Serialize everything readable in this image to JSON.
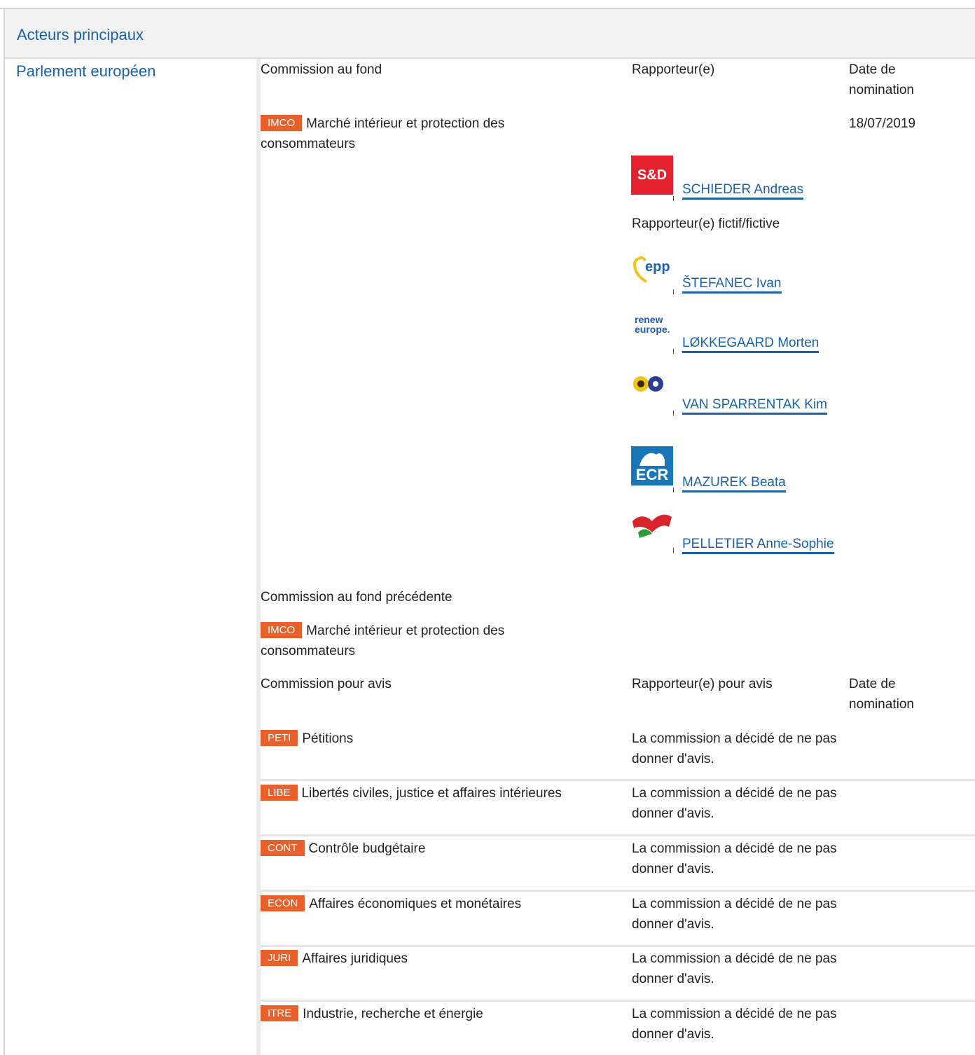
{
  "header": {
    "title": "Acteurs principaux"
  },
  "sidebar": {
    "label": "Parlement européen"
  },
  "lead": {
    "col_committee": "Commission au fond",
    "col_rapporteur": "Rapporteur(e)",
    "col_date": "Date de nomination",
    "committee": {
      "code": "IMCO",
      "name": "Marché intérieur et protection des consommateurs"
    },
    "date": "18/07/2019",
    "rapporteur": {
      "group": "S&D",
      "name": "SCHIEDER Andreas"
    },
    "shadow_label": "Rapporteur(e) fictif/fictive",
    "shadows": [
      {
        "group": "epp",
        "name": "ŠTEFANEC Ivan"
      },
      {
        "group": "renew europe.",
        "name": "LØKKEGAARD Morten"
      },
      {
        "group": "Verts/ALE",
        "name": "VAN SPARRENTAK Kim"
      },
      {
        "group": "ECR",
        "name": "MAZUREK Beata"
      },
      {
        "group": "GUE/NGL",
        "name": "PELLETIER Anne-Sophie"
      }
    ]
  },
  "previous": {
    "label": "Commission au fond précédente",
    "committee": {
      "code": "IMCO",
      "name": "Marché intérieur et protection des consommateurs"
    }
  },
  "opinion": {
    "col_committee": "Commission pour avis",
    "col_rapporteur": "Rapporteur(e) pour avis",
    "col_date": "Date de nomination",
    "rows": [
      {
        "code": "PETI",
        "name": "Pétitions",
        "status": "La commission a décidé de ne pas donner d'avis."
      },
      {
        "code": "LIBE",
        "name": "Libertés civiles, justice et affaires intérieures",
        "status": "La commission a décidé de ne pas donner d'avis."
      },
      {
        "code": "CONT",
        "name": "Contrôle budgétaire",
        "status": "La commission a décidé de ne pas donner d'avis."
      },
      {
        "code": "ECON",
        "name": "Affaires économiques et monétaires",
        "status": "La commission a décidé de ne pas donner d'avis."
      },
      {
        "code": "JURI",
        "name": "Affaires juridiques",
        "status": "La commission a décidé de ne pas donner d'avis."
      },
      {
        "code": "ITRE",
        "name": "Industrie, recherche et énergie",
        "status": "La commission a décidé de ne pas donner d'avis."
      }
    ]
  },
  "colors": {
    "link": "#1a62a8",
    "badge": "#e8612c",
    "header_bg": "#f2f2f2"
  }
}
